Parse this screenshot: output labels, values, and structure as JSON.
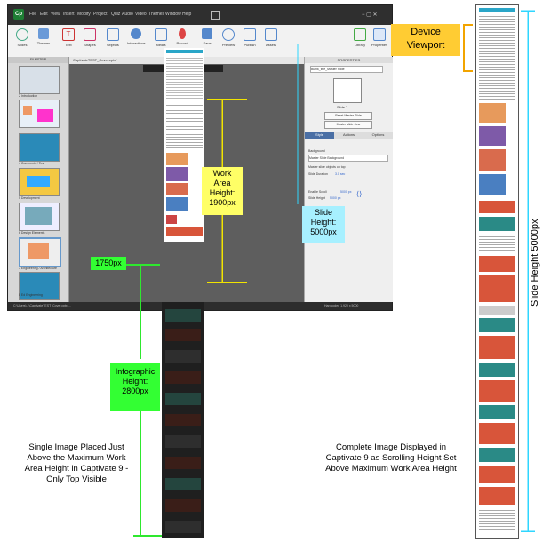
{
  "window": {
    "logo": "Cp",
    "menus": [
      "File",
      "Edit",
      "View",
      "Insert",
      "Modify",
      "Project",
      "Quiz",
      "Audio",
      "Video",
      "Themes",
      "Window",
      "Help"
    ],
    "toolbar": [
      "Slides",
      "Themes",
      "Text",
      "Shapes",
      "Objects",
      "Interactions",
      "Media",
      "Record",
      "Save",
      "Preview",
      "Publish",
      "Assets",
      "Library",
      "Properties"
    ],
    "tab_title": "CaptivateTEST_Cover.cptx*",
    "filmstrip_header": "FILMSTRIP",
    "slide_labels": [
      "2 Introduction",
      "",
      "4 Comments / Test",
      "5 Development",
      "6 Design Elements",
      "7 Engineering / Architecture",
      "8 Ed Engineering"
    ],
    "props": {
      "header": "PROPERTIES",
      "master_slide": "Blank_title_Master Slide",
      "style_label": "Slide 7",
      "btn_reset": "Reset Master Slide",
      "btn_apply": "Master slide view",
      "tabs": [
        "Style",
        "Actions",
        "Options"
      ],
      "background": "Background",
      "bg_value": "Master Slide Background",
      "use_master": "Master slide objects on top",
      "duration": "Slide Duration",
      "duration_val": "3.0 sec",
      "scroll": "Enable Scroll",
      "scroll_val": "5000 px",
      "slide_height": "Slide Height",
      "slide_height_val": "5000 px"
    },
    "status": "C:\\Users\\...\\CaptivateTEST_Cover.cptx  ...",
    "status_right": "Hardcoded  1,920 x 5000"
  },
  "annotations": {
    "device_viewport": "Device Viewport",
    "work_area": "Work Area Height: 1900px",
    "work_area_lines": [
      "Work",
      "Area",
      "Height:",
      "1900px"
    ],
    "slide_height_box": [
      "Slide",
      "Height:",
      "5000px"
    ],
    "marker_1750": "1750px",
    "infographic": [
      "Infographic",
      "Height:",
      "2800px"
    ],
    "left_caption": [
      "Single Image Placed Just",
      "Above the Maximum Work",
      "Area Height in Captivate 9 -",
      "Only Top Visible"
    ],
    "right_caption": [
      "Complete Image Displayed in",
      "Captivate 9 as Scrolling Height Set",
      "Above Maximum Work Area Height"
    ],
    "vertical_label": "Slide Height 5000px"
  },
  "colors": {
    "yellow_box": "#ffff66",
    "cyan_box": "#a7f0ff",
    "green_box": "#33ff33",
    "orange_box": "#ffcc33",
    "yellow_line": "#f2e400",
    "green_line": "#2ee82e",
    "cyan_line": "#2fd6ff",
    "orange_line": "#f2a400"
  }
}
